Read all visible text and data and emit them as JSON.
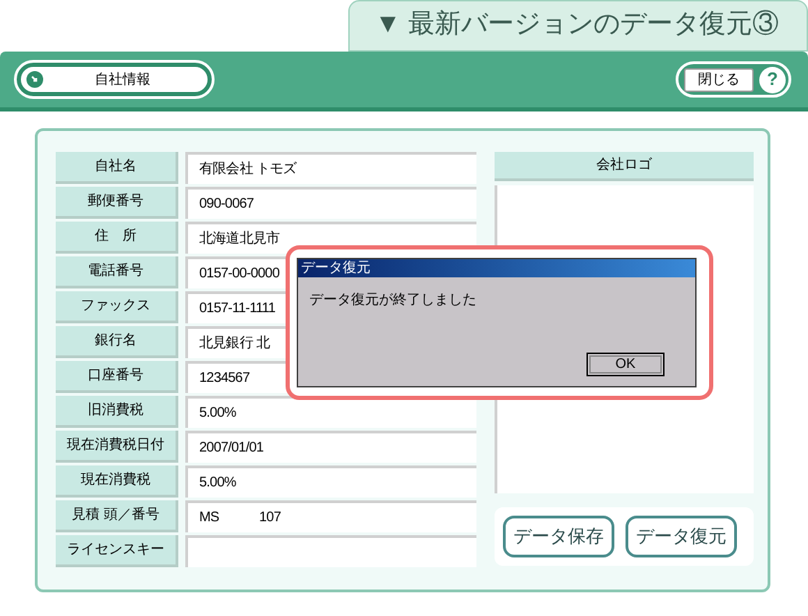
{
  "banner": {
    "title": "▼ 最新バージョンのデータ復元③"
  },
  "toolbar": {
    "section_button": "自社情報",
    "close_button": "閉じる",
    "help_button": "?"
  },
  "fields": [
    {
      "label": "自社名",
      "value": "有限会社 トモズ"
    },
    {
      "label": "郵便番号",
      "value": "090-0067"
    },
    {
      "label": "住　所",
      "value": "北海道北見市"
    },
    {
      "label": "電話番号",
      "value": "0157-00-0000"
    },
    {
      "label": "ファックス",
      "value": "0157-11-1111"
    },
    {
      "label": "銀行名",
      "value": "北見銀行 北"
    },
    {
      "label": "口座番号",
      "value": "1234567"
    },
    {
      "label": "旧消費税",
      "value": "5.00%"
    },
    {
      "label": "現在消費税日付",
      "value": "2007/01/01"
    },
    {
      "label": "現在消費税",
      "value": "5.00%"
    },
    {
      "label": "見積 頭／番号",
      "value": "MS　　　107"
    },
    {
      "label": "ライセンスキー"
    }
  ],
  "logo_panel": {
    "header": "会社ロゴ"
  },
  "actions": [
    "データ保存",
    "データ復元"
  ],
  "dialog": {
    "title": "データ復元",
    "message": "データ復元が終了しました",
    "button": "OK"
  }
}
